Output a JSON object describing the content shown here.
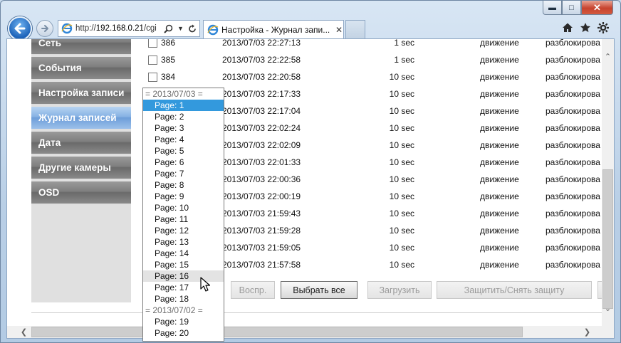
{
  "browser": {
    "url_prefix": "http://",
    "url_host": "192.168.0.21",
    "url_path": "/cgi",
    "tab_title": "Настройка - Журнал запи..."
  },
  "sidebar": {
    "items": [
      {
        "label": "Сеть"
      },
      {
        "label": "События"
      },
      {
        "label": "Настройка записи"
      },
      {
        "label": "Журнал записей"
      },
      {
        "label": "Дата"
      },
      {
        "label": "Другие камеры"
      },
      {
        "label": "OSD"
      }
    ],
    "active_index": 3
  },
  "table": {
    "rows": [
      {
        "id": "386",
        "time": "2013/07/03 22:27:13",
        "duration": "1 sec",
        "event": "движение",
        "status": "разблокирова"
      },
      {
        "id": "385",
        "time": "2013/07/03 22:22:58",
        "duration": "1 sec",
        "event": "движение",
        "status": "разблокирова"
      },
      {
        "id": "384",
        "time": "2013/07/03 22:20:58",
        "duration": "10 sec",
        "event": "движение",
        "status": "разблокирова"
      },
      {
        "id": "",
        "time": "2013/07/03 22:17:33",
        "duration": "10 sec",
        "event": "движение",
        "status": "разблокирова"
      },
      {
        "id": "",
        "time": "2013/07/03 22:17:04",
        "duration": "10 sec",
        "event": "движение",
        "status": "разблокирова"
      },
      {
        "id": "",
        "time": "2013/07/03 22:02:24",
        "duration": "10 sec",
        "event": "движение",
        "status": "разблокирова"
      },
      {
        "id": "",
        "time": "2013/07/03 22:02:09",
        "duration": "10 sec",
        "event": "движение",
        "status": "разблокирова"
      },
      {
        "id": "",
        "time": "2013/07/03 22:01:33",
        "duration": "10 sec",
        "event": "движение",
        "status": "разблокирова"
      },
      {
        "id": "",
        "time": "2013/07/03 22:00:36",
        "duration": "10 sec",
        "event": "движение",
        "status": "разблокирова"
      },
      {
        "id": "",
        "time": "2013/07/03 22:00:19",
        "duration": "10 sec",
        "event": "движение",
        "status": "разблокирова"
      },
      {
        "id": "",
        "time": "2013/07/03 21:59:43",
        "duration": "10 sec",
        "event": "движение",
        "status": "разблокирова"
      },
      {
        "id": "",
        "time": "2013/07/03 21:59:28",
        "duration": "10 sec",
        "event": "движение",
        "status": "разблокирова"
      },
      {
        "id": "",
        "time": "2013/07/03 21:59:05",
        "duration": "10 sec",
        "event": "движение",
        "status": "разблокирова"
      },
      {
        "id": "",
        "time": "2013/07/03 21:57:58",
        "duration": "10 sec",
        "event": "движение",
        "status": "разблокирова"
      }
    ]
  },
  "buttons": {
    "play": "Воспр.",
    "select_all": "Выбрать все",
    "download": "Загрузить",
    "protect": "Защитить/Снять защиту"
  },
  "dropdown": {
    "items": [
      {
        "label": "= 2013/07/03 =",
        "type": "group"
      },
      {
        "label": "Page: 1",
        "type": "selected"
      },
      {
        "label": "Page: 2",
        "type": "option"
      },
      {
        "label": "Page: 3",
        "type": "option"
      },
      {
        "label": "Page: 4",
        "type": "option"
      },
      {
        "label": "Page: 5",
        "type": "option"
      },
      {
        "label": "Page: 6",
        "type": "option"
      },
      {
        "label": "Page: 7",
        "type": "option"
      },
      {
        "label": "Page: 8",
        "type": "option"
      },
      {
        "label": "Page: 9",
        "type": "option"
      },
      {
        "label": "Page: 10",
        "type": "option"
      },
      {
        "label": "Page: 11",
        "type": "option"
      },
      {
        "label": "Page: 12",
        "type": "option"
      },
      {
        "label": "Page: 13",
        "type": "option"
      },
      {
        "label": "Page: 14",
        "type": "option"
      },
      {
        "label": "Page: 15",
        "type": "option"
      },
      {
        "label": "Page: 16",
        "type": "hover"
      },
      {
        "label": "Page: 17",
        "type": "option"
      },
      {
        "label": "Page: 18",
        "type": "option"
      },
      {
        "label": "= 2013/07/02 =",
        "type": "group"
      },
      {
        "label": "Page: 19",
        "type": "option"
      },
      {
        "label": "Page: 20",
        "type": "option"
      }
    ]
  },
  "colors": {
    "selection": "#3399dd",
    "sidebar_active": "#86b2e4",
    "sidebar_item": "#7e7e7e"
  }
}
